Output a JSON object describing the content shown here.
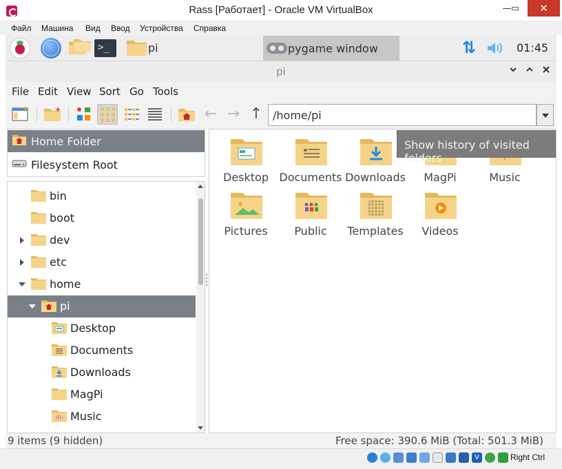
{
  "window": {
    "title": "Rass [Работает] - Oracle VM VirtualBox",
    "min_glyph": "—",
    "max_glyph": "▭",
    "close_glyph": "✕"
  },
  "vbox_menu": [
    "Файл",
    "Машина",
    "Вид",
    "Ввод",
    "Устройства",
    "Справка"
  ],
  "taskbar": {
    "terminal_glyph": ">_",
    "folder_label": "pi",
    "task_label": "pygame window",
    "clock": "01:45",
    "icons": [
      "raspberry-menu-icon",
      "web-browser-icon",
      "file-manager-icon",
      "terminal-icon",
      "folder-icon",
      "gamepad-icon",
      "network-icon",
      "volume-icon"
    ]
  },
  "fm": {
    "title": "pi",
    "menu": [
      "File",
      "Edit",
      "View",
      "Sort",
      "Go",
      "Tools"
    ],
    "path": "/home/pi",
    "tooltip": "Show history of visited folders",
    "toolbar_icons": [
      "new-window-icon",
      "new-folder-icon",
      "thumbnail-view-icon",
      "icon-view-icon",
      "compact-view-icon",
      "list-view-icon",
      "home-icon",
      "back-icon",
      "forward-icon",
      "up-icon"
    ]
  },
  "places": [
    {
      "label": "Home Folder",
      "icon": "home-folder-icon",
      "selected": true
    },
    {
      "label": "Filesystem Root",
      "icon": "drive-icon",
      "selected": false
    }
  ],
  "tree": [
    {
      "label": "bin",
      "depth": 0,
      "expander": "none",
      "icon": "folder-icon"
    },
    {
      "label": "boot",
      "depth": 0,
      "expander": "none",
      "icon": "folder-icon"
    },
    {
      "label": "dev",
      "depth": 0,
      "expander": "collapsed",
      "icon": "folder-icon"
    },
    {
      "label": "etc",
      "depth": 0,
      "expander": "collapsed",
      "icon": "folder-icon"
    },
    {
      "label": "home",
      "depth": 0,
      "expander": "expanded",
      "icon": "folder-icon"
    },
    {
      "label": "pi",
      "depth": 1,
      "expander": "expanded",
      "icon": "home-folder-icon",
      "selected": true
    },
    {
      "label": "Desktop",
      "depth": 2,
      "expander": "none",
      "icon": "desktop-folder-icon"
    },
    {
      "label": "Documents",
      "depth": 2,
      "expander": "none",
      "icon": "documents-folder-icon"
    },
    {
      "label": "Downloads",
      "depth": 2,
      "expander": "none",
      "icon": "downloads-folder-icon"
    },
    {
      "label": "MagPi",
      "depth": 2,
      "expander": "none",
      "icon": "folder-icon"
    },
    {
      "label": "Music",
      "depth": 2,
      "expander": "none",
      "icon": "music-folder-icon"
    }
  ],
  "files": [
    {
      "label": "Desktop",
      "icon": "desktop-folder-icon"
    },
    {
      "label": "Documents",
      "icon": "documents-folder-icon"
    },
    {
      "label": "Downloads",
      "icon": "downloads-folder-icon"
    },
    {
      "label": "MagPi",
      "icon": "magpi-folder-icon"
    },
    {
      "label": "Music",
      "icon": "music-folder-icon"
    },
    {
      "label": "Pictures",
      "icon": "pictures-folder-icon"
    },
    {
      "label": "Public",
      "icon": "public-folder-icon"
    },
    {
      "label": "Templates",
      "icon": "templates-folder-icon"
    },
    {
      "label": "Videos",
      "icon": "videos-folder-icon"
    }
  ],
  "status": {
    "items": "9 items (9 hidden)",
    "free": "Free space: 390.6 MiB (Total: 501.3 MiB)"
  },
  "vbox_status": {
    "host_key": "Right Ctrl",
    "icons": [
      "hard-disk-icon",
      "optical-drive-icon",
      "audio-icon",
      "network-adapter-icon",
      "usb-icon",
      "shared-folders-icon",
      "display-icon",
      "video-capture-icon",
      "virtualization-icon",
      "mouse-integration-icon",
      "keyboard-capture-icon",
      "host-key-icon"
    ]
  },
  "colors": {
    "selection": "#7b8088",
    "folder": "#f5d48a",
    "folder_dark": "#e3b95c",
    "accent_blue": "#1e88e5",
    "close_red": "#c7392b"
  }
}
